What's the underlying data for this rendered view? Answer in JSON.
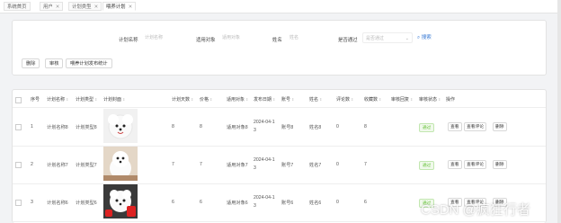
{
  "tabs": [
    {
      "label": "系统首页",
      "closable": false,
      "active": false
    },
    {
      "label": "用户",
      "closable": true,
      "active": false
    },
    {
      "label": "计划类型",
      "closable": true,
      "active": false
    },
    {
      "label": "喂养计划",
      "closable": true,
      "active": true
    }
  ],
  "search": {
    "plan_name_label": "计划名称",
    "plan_name_placeholder": "计划名称",
    "target_label": "适用对象",
    "target_placeholder": "适用对象",
    "account_name_label": "姓名",
    "account_name_placeholder": "姓名",
    "review_label": "是否通过",
    "review_placeholder": "是否通过",
    "search_label": "搜索"
  },
  "toolbar": {
    "delete_label": "删除",
    "review_label": "审核",
    "stats_label": "喂养计划发布统计"
  },
  "table": {
    "columns": [
      "序号",
      "计划名称",
      "计划类型",
      "计划封面",
      "计划天数",
      "价格",
      "适用对象",
      "发布日期",
      "账号",
      "姓名",
      "评论数",
      "收藏数",
      "审核回复",
      "审核状态",
      "操作"
    ],
    "rows": [
      {
        "index": "1",
        "name": "计划名称8",
        "type": "计划类型8",
        "days": "8",
        "price": "8",
        "target": "适用对象8",
        "date": "2024-04-1\n3",
        "account": "账号8",
        "person": "姓名8",
        "comments": "0",
        "favorites": "8",
        "reply": "",
        "status": "通过",
        "view": "查看",
        "view_comments": "查看评论",
        "delete": "删除"
      },
      {
        "index": "2",
        "name": "计划名称7",
        "type": "计划类型7",
        "days": "7",
        "price": "7",
        "target": "适用对象7",
        "date": "2024-04-1\n3",
        "account": "账号7",
        "person": "姓名7",
        "comments": "0",
        "favorites": "7",
        "reply": "",
        "status": "通过",
        "view": "查看",
        "view_comments": "查看评论",
        "delete": "删除"
      },
      {
        "index": "3",
        "name": "计划名称6",
        "type": "计划类型6",
        "days": "6",
        "price": "6",
        "target": "适用对象6",
        "date": "2024-04-1\n3",
        "account": "账号6",
        "person": "姓名6",
        "comments": "0",
        "favorites": "6",
        "reply": "",
        "status": "通过",
        "view": "查看",
        "view_comments": "查看评论",
        "delete": "删除"
      }
    ]
  },
  "watermark": "CSDN @疯狂行者",
  "colors": {
    "accent": "#3a7bd5",
    "status_pass": "#67c23a"
  },
  "icons": {
    "search": "search-icon",
    "close": "close-icon",
    "chevron": "chevron-down-icon",
    "sort": "sort-icon"
  }
}
